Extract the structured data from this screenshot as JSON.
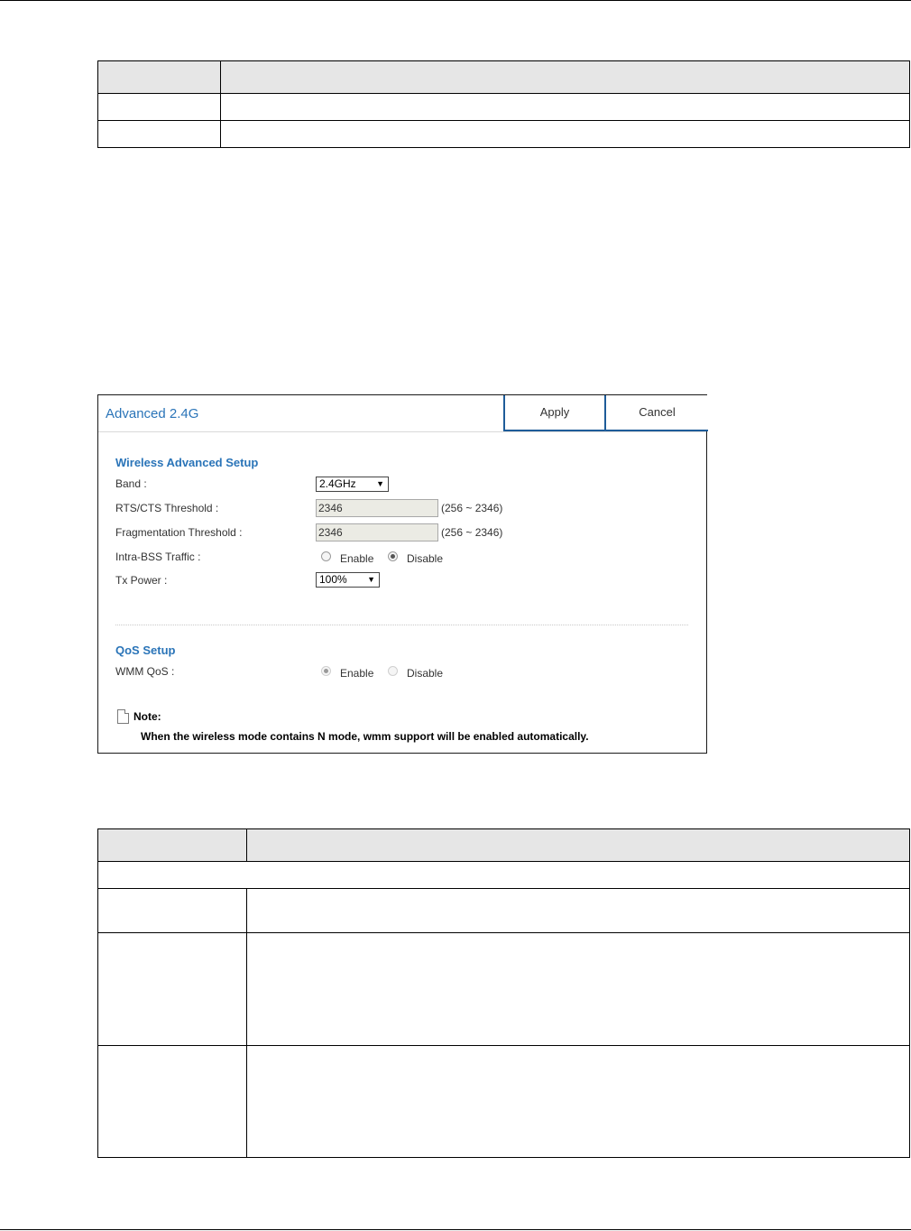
{
  "panel": {
    "title": "Advanced 2.4G",
    "apply_label": "Apply",
    "cancel_label": "Cancel",
    "wireless_section": {
      "title": "Wireless Advanced Setup",
      "band_label": "Band :",
      "band_value": "2.4GHz",
      "rts_label": "RTS/CTS Threshold :",
      "rts_value": "2346",
      "rts_range": "(256 ~ 2346)",
      "frag_label": "Fragmentation Threshold :",
      "frag_value": "2346",
      "frag_range": "(256 ~ 2346)",
      "intra_label": "Intra-BSS Traffic :",
      "intra_enable": "Enable",
      "intra_disable": "Disable",
      "intra_selected": "Disable",
      "tx_label": "Tx Power :",
      "tx_value": "100%"
    },
    "qos_section": {
      "title": "QoS Setup",
      "wmm_label": "WMM QoS :",
      "wmm_enable": "Enable",
      "wmm_disable": "Disable",
      "wmm_selected": "Enable"
    },
    "note": {
      "title": "Note:",
      "text": "When the wireless mode contains N mode, wmm support will be enabled automatically."
    }
  }
}
